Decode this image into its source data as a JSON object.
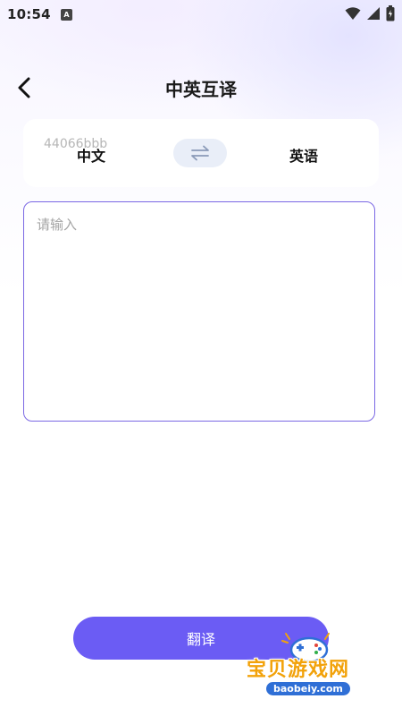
{
  "status_bar": {
    "time": "10:54",
    "badge_letter": "A",
    "icons": [
      "wifi-icon",
      "signal-icon",
      "battery-icon"
    ]
  },
  "header": {
    "title": "中英互译",
    "back_icon": "chevron-left-icon"
  },
  "language_selector": {
    "overlay_text": "44066bbb",
    "source_language": "中文",
    "target_language": "英语",
    "swap_icon": "swap-arrows-icon"
  },
  "input": {
    "placeholder": "请输入",
    "value": ""
  },
  "actions": {
    "translate_label": "翻译"
  },
  "watermark": {
    "brand_text": "宝贝游戏网",
    "domain": "baobeiy.com"
  },
  "colors": {
    "accent": "#6b5cf4",
    "input_border": "#7b68e4",
    "swap_bg": "#e9eef8",
    "logo_orange": "#f2a20a",
    "logo_blue": "#2f6fd6"
  }
}
